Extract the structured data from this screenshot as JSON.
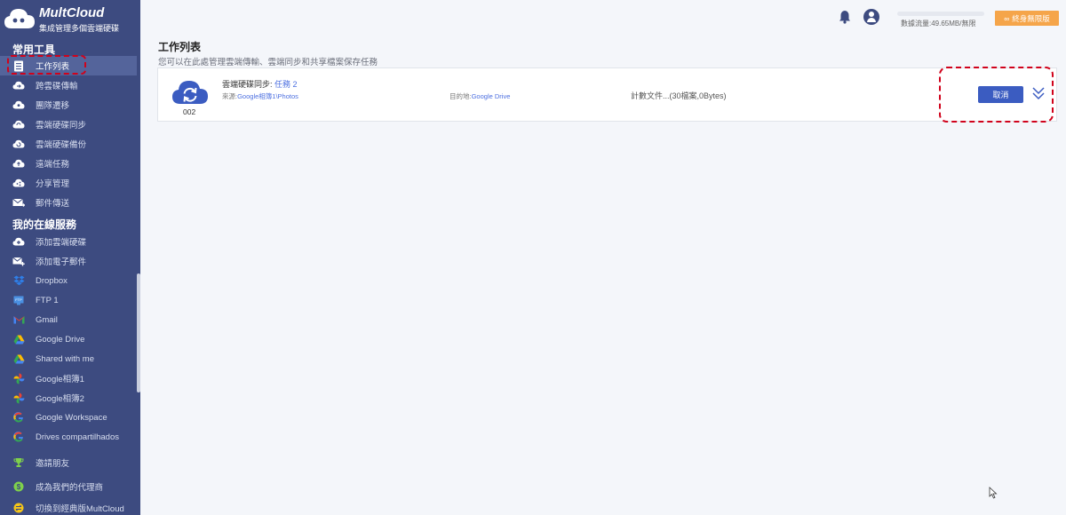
{
  "app": {
    "logo_title": "MultCloud",
    "logo_subtitle": "集成管理多個雲端硬碟"
  },
  "sidebar": {
    "section_common": "常用工具",
    "section_services": "我的在線服務",
    "common_items": [
      {
        "label": "工作列表",
        "icon": "task-list-icon",
        "active": true
      },
      {
        "label": "跨雲碟傳輸",
        "icon": "cloud-transfer-icon"
      },
      {
        "label": "團隊遷移",
        "icon": "team-migration-icon"
      },
      {
        "label": "雲端硬碟同步",
        "icon": "cloud-sync-icon"
      },
      {
        "label": "雲端硬碟備份",
        "icon": "cloud-backup-icon"
      },
      {
        "label": "遠端任務",
        "icon": "remote-upload-icon"
      },
      {
        "label": "分享管理",
        "icon": "share-icon"
      },
      {
        "label": "郵件傳送",
        "icon": "email-migration-icon"
      }
    ],
    "service_items": [
      {
        "label": "添加雲端硬碟",
        "icon": "add-cloud-icon"
      },
      {
        "label": "添加電子郵件",
        "icon": "add-email-icon"
      },
      {
        "label": "Dropbox",
        "icon": "dropbox-icon"
      },
      {
        "label": "FTP 1",
        "icon": "ftp-icon"
      },
      {
        "label": "Gmail",
        "icon": "gmail-icon"
      },
      {
        "label": "Google Drive",
        "icon": "google-drive-icon"
      },
      {
        "label": "Shared with me",
        "icon": "shared-drive-icon"
      },
      {
        "label": "Google相簿1",
        "icon": "google-photos-icon"
      },
      {
        "label": "Google相簿2",
        "icon": "google-photos-icon"
      },
      {
        "label": "Google Workspace",
        "icon": "google-icon"
      },
      {
        "label": "Drives compartilhados",
        "icon": "google-icon"
      }
    ],
    "bottom_items": [
      {
        "label": "邀請朋友",
        "icon": "trophy-icon"
      },
      {
        "label": "成為我們的代理商",
        "icon": "dollar-icon"
      },
      {
        "label": "切換到經典版MultCloud",
        "icon": "switch-icon"
      }
    ]
  },
  "topbar": {
    "traffic_label": "數據流量:49.65MB/無限",
    "upgrade_label": "終身無限版"
  },
  "main": {
    "title": "工作列表",
    "description": "您可以在此處管理雲端傳輸、雲端同步和共享檔案保存任務",
    "task": {
      "number": "002",
      "name_prefix": "雲端硬碟同步: ",
      "name_link": "任務 2",
      "source_prefix": "來源:",
      "source_value": "Google相簿1\\Photos",
      "dest_prefix": "目的地:",
      "dest_value": "Google Drive",
      "status": "計數文件...(30檔案,0Bytes)",
      "cancel_label": "取消"
    }
  },
  "colors": {
    "sidebar_bg": "#3d4b80",
    "accent_blue": "#3b5cc1",
    "upgrade_orange": "#f5a54a",
    "highlight_red": "#d0021b"
  }
}
